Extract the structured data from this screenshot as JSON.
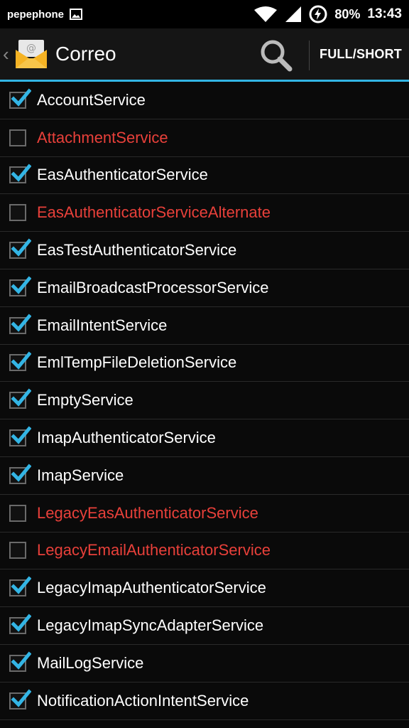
{
  "status": {
    "carrier": "pepephone",
    "battery": "80%",
    "time": "13:43"
  },
  "action_bar": {
    "title": "Correo",
    "mode_button": "FULL/SHORT"
  },
  "colors": {
    "accent": "#33b5e5",
    "disabled_text": "#e8403a",
    "enabled_text": "#ffffff"
  },
  "services": [
    {
      "name": "AccountService",
      "checked": true
    },
    {
      "name": "AttachmentService",
      "checked": false
    },
    {
      "name": "EasAuthenticatorService",
      "checked": true
    },
    {
      "name": "EasAuthenticatorServiceAlternate",
      "checked": false
    },
    {
      "name": "EasTestAuthenticatorService",
      "checked": true
    },
    {
      "name": "EmailBroadcastProcessorService",
      "checked": true
    },
    {
      "name": "EmailIntentService",
      "checked": true
    },
    {
      "name": "EmlTempFileDeletionService",
      "checked": true
    },
    {
      "name": "EmptyService",
      "checked": true
    },
    {
      "name": "ImapAuthenticatorService",
      "checked": true
    },
    {
      "name": "ImapService",
      "checked": true
    },
    {
      "name": "LegacyEasAuthenticatorService",
      "checked": false
    },
    {
      "name": "LegacyEmailAuthenticatorService",
      "checked": false
    },
    {
      "name": "LegacyImapAuthenticatorService",
      "checked": true
    },
    {
      "name": "LegacyImapSyncAdapterService",
      "checked": true
    },
    {
      "name": "MailLogService",
      "checked": true
    },
    {
      "name": "NotificationActionIntentService",
      "checked": true
    }
  ]
}
